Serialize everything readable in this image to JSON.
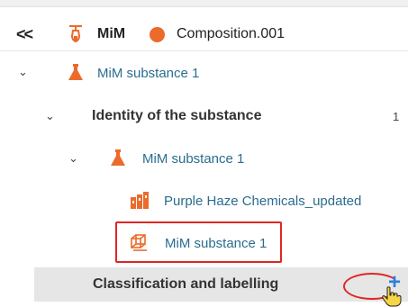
{
  "header": {
    "collapse_label": "<<",
    "project_name": "MiM",
    "composition_name": "Composition.001",
    "composition_color": "#ec6a2b"
  },
  "tree": {
    "substance": {
      "label": "MiM substance 1",
      "icon": "flask-icon"
    },
    "identity": {
      "label": "Identity of the substance",
      "count": "1"
    },
    "identity_substance": {
      "label": "MiM substance 1",
      "icon": "flask-icon"
    },
    "legal_entity": {
      "label": "Purple Haze Chemicals_updated",
      "icon": "factory-icon"
    },
    "reference_substance": {
      "label": "MiM substance 1",
      "icon": "molecule-icon"
    },
    "classification": {
      "label": "Classification and labelling",
      "add_icon": "plus-icon"
    }
  },
  "colors": {
    "accent_orange": "#ec6a2b",
    "link_blue": "#2a6d8f",
    "highlight_red": "#e02626",
    "add_blue": "#2d7ee0"
  }
}
